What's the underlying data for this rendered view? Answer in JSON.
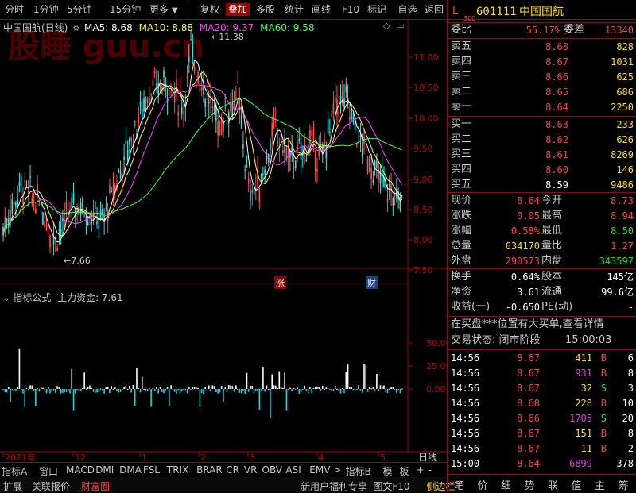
{
  "toolbar": {
    "left_items": [
      "分时",
      "1分钟",
      "5分钟",
      "15分钟",
      "更多"
    ],
    "right_items": [
      "复权",
      "叠加",
      "多股",
      "统计",
      "画线",
      "F10",
      "标记",
      "-自选",
      "返回"
    ],
    "selected": "叠加"
  },
  "chart_header": {
    "name": "中国国航(日线)",
    "ma5": "MA5: 8.68",
    "ma10": "MA10: 8.88",
    "ma20": "MA20: 9.37",
    "ma60": "MA60: 9.58",
    "watermark": "股睡 guu.cn",
    "colors": {
      "ma5": "#ffffff",
      "ma10": "#ffff40",
      "ma20": "#ff40ff",
      "ma60": "#40ff40"
    }
  },
  "price_axis": [
    "11.00",
    "10.50",
    "10.00",
    "9.50",
    "9.00",
    "8.50",
    "8.00",
    "7.50"
  ],
  "annotations": {
    "high": "11.38",
    "low": "7.66",
    "zhang": "涨",
    "cai": "财"
  },
  "indicator": {
    "title": "指标公式",
    "subtitle": "主力资金: 7.61",
    "axis": [
      "50.00",
      "25.00",
      "0.00"
    ]
  },
  "date_axis": [
    "2021年",
    "12",
    "1",
    "2",
    "3",
    "4",
    "5"
  ],
  "date_period": "日线",
  "tabs_row1": [
    "指标A",
    "窗口",
    "MACD",
    "DMI",
    "DMA",
    "FSL",
    "TRIX",
    "BRAR",
    "CR",
    "VR",
    "OBV",
    "ASI",
    "EMV",
    ">",
    "指标B",
    "模",
    "板",
    "+",
    "-"
  ],
  "tabs_row2": [
    "扩展",
    "关联报价",
    "财富圈"
  ],
  "tabs_row2_right": [
    "新用户福利专享",
    "图文F10",
    "侧边栏"
  ],
  "right": {
    "code_prefix": "L",
    "code_sub": "300",
    "code": "601111",
    "name": "中国国航",
    "weibi_label": "委比",
    "weibi": "55.17%",
    "weicha_label": "委差",
    "weicha": "13340",
    "sells": [
      {
        "label": "卖五",
        "price": "8.68",
        "vol": "828"
      },
      {
        "label": "卖四",
        "price": "8.67",
        "vol": "1031"
      },
      {
        "label": "卖三",
        "price": "8.66",
        "vol": "625"
      },
      {
        "label": "卖二",
        "price": "8.65",
        "vol": "686"
      },
      {
        "label": "卖一",
        "price": "8.64",
        "vol": "2250"
      }
    ],
    "buys": [
      {
        "label": "买一",
        "price": "8.63",
        "vol": "233"
      },
      {
        "label": "买二",
        "price": "8.62",
        "vol": "626"
      },
      {
        "label": "买三",
        "price": "8.61",
        "vol": "8269"
      },
      {
        "label": "买四",
        "price": "8.60",
        "vol": "146"
      },
      {
        "label": "买五",
        "price": "8.59",
        "vol": "9486"
      }
    ],
    "stats": [
      {
        "l1": "现价",
        "v1": "8.64",
        "l2": "今开",
        "v2": "8.73"
      },
      {
        "l1": "涨跌",
        "v1": "0.05",
        "l2": "最高",
        "v2": "8.94"
      },
      {
        "l1": "涨幅",
        "v1": "0.58%",
        "l2": "最低",
        "v2": "8.50"
      },
      {
        "l1": "总量",
        "v1": "634170",
        "l2": "量比",
        "v2": "1.27"
      },
      {
        "l1": "外盘",
        "v1": "290573",
        "l2": "内盘",
        "v2": "343597"
      }
    ],
    "stats2": [
      {
        "l1": "换手",
        "v1": "0.64%",
        "l2": "股本",
        "v2": "145亿"
      },
      {
        "l1": "净资",
        "v1": "3.61",
        "l2": "流通",
        "v2": "99.6亿"
      },
      {
        "l1": "收益(一)",
        "v1": "-0.650",
        "l2": "PE(动)",
        "v2": "-"
      }
    ],
    "notice": "在买盘***位置有大买单,查看详情",
    "trade_state_label": "交易状态: 闭市阶段",
    "trade_state_time": "15:00:03",
    "ticks": [
      {
        "t": "14:56",
        "p": "8.67",
        "v": "411",
        "s": "B",
        "n": "6"
      },
      {
        "t": "14:56",
        "p": "8.67",
        "v": "931",
        "s": "B",
        "n": "8"
      },
      {
        "t": "14:56",
        "p": "8.67",
        "v": "32",
        "s": "S",
        "n": "3"
      },
      {
        "t": "14:56",
        "p": "8.68",
        "v": "228",
        "s": "B",
        "n": "10"
      },
      {
        "t": "14:56",
        "p": "8.66",
        "v": "1705",
        "s": "S",
        "n": "20"
      },
      {
        "t": "14:56",
        "p": "8.67",
        "v": "151",
        "s": "B",
        "n": "8"
      },
      {
        "t": "14:56",
        "p": "8.67",
        "v": "11",
        "s": "B",
        "n": "2"
      },
      {
        "t": "15:00",
        "p": "8.64",
        "v": "6899",
        "s": "",
        "n": "378"
      }
    ],
    "bottom_tabs": [
      "笔",
      "价",
      "细",
      "势",
      "联",
      "值",
      "主",
      "筹"
    ]
  }
}
